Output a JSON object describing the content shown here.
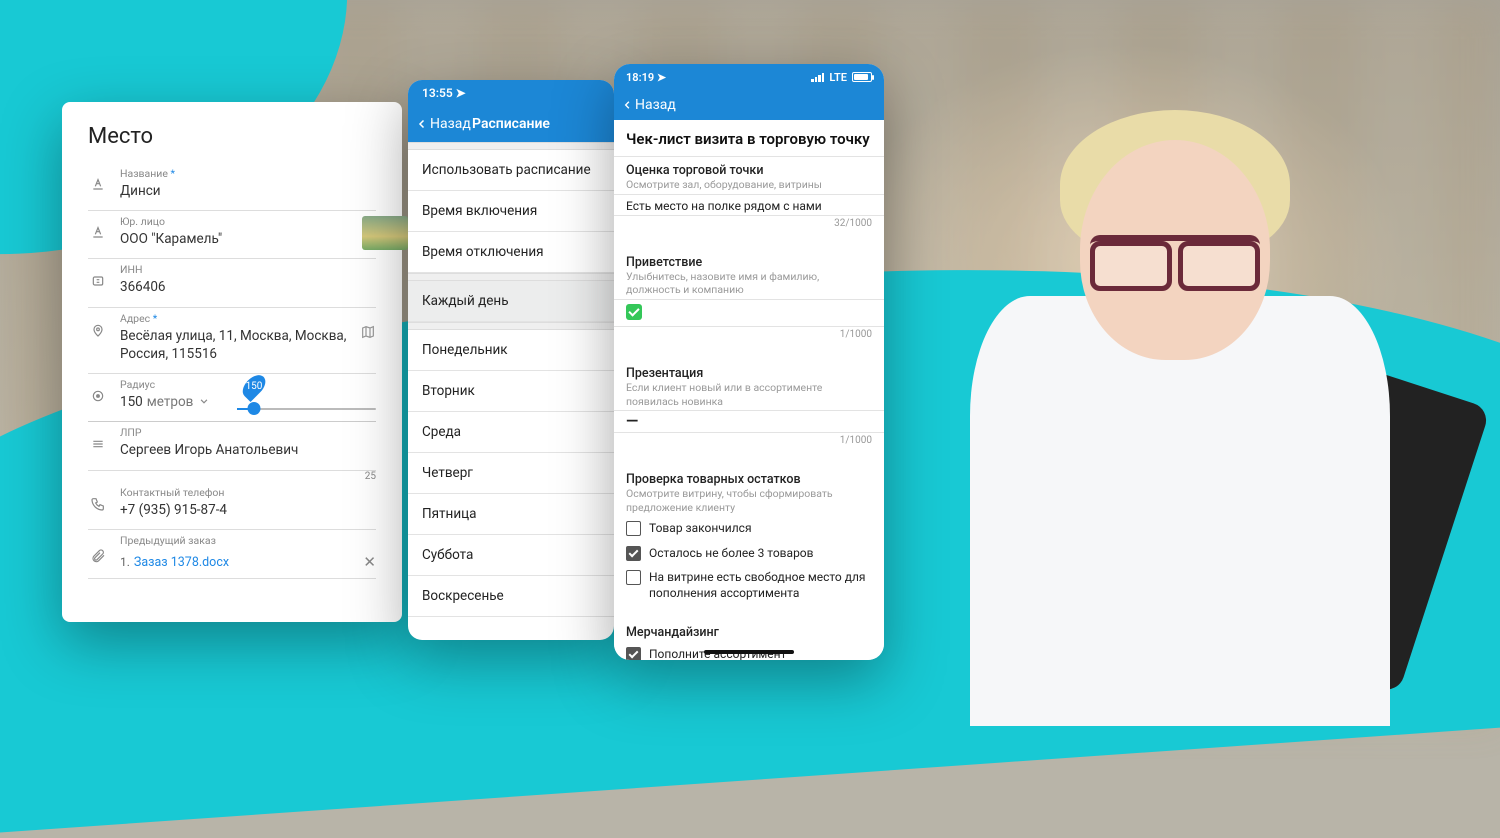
{
  "colors": {
    "accent": "#1c87d6",
    "teal": "#18c9d4",
    "link": "#1e88e5",
    "success": "#34c759"
  },
  "card1": {
    "title": "Место",
    "name": {
      "label": "Название",
      "value": "Динси"
    },
    "legal": {
      "label": "Юр. лицо",
      "value": "ООО \"Карамель\""
    },
    "inn": {
      "label": "ИНН",
      "value": "366406"
    },
    "address": {
      "label": "Адрес",
      "value": "Весёлая улица, 11, Москва, Москва, Россия, 115516"
    },
    "radius": {
      "label": "Радиус",
      "value": "150",
      "unit": "метров",
      "pin": "150",
      "percent": 12
    },
    "lpr": {
      "label": "ЛПР",
      "value": "Сергеев Игорь Анатольевич",
      "count": "25"
    },
    "phone": {
      "label": "Контактный телефон",
      "value": "+7 (935) 915-87-4"
    },
    "prev_order": {
      "label": "Предыдущий заказ",
      "file_num": "1.",
      "file_name": "Зазаз 1378.docx"
    }
  },
  "card2": {
    "time": "13:55",
    "back": "Назад",
    "title": "Расписание",
    "rows_top": [
      "Использовать расписание",
      "Время включения",
      "Время отключения"
    ],
    "rows_daily": "Каждый день",
    "days": [
      "Понедельник",
      "Вторник",
      "Среда",
      "Четверг",
      "Пятница",
      "Суббота",
      "Воскресенье"
    ]
  },
  "card3": {
    "time": "18:19",
    "net": "LTE",
    "back": "Назад",
    "title": "Чек-лист визита в торговую точку",
    "s1": {
      "title": "Оценка торговой точки",
      "sub": "Осмотрите зал, оборудование, витрины",
      "note": "Есть место на полке рядом с нами",
      "count": "32/1000"
    },
    "s2": {
      "title": "Приветствие",
      "sub": "Улыбнитесь, назовите имя и фамилию, должность и компанию",
      "count": "1/1000"
    },
    "s3": {
      "title": "Презентация",
      "sub": "Если клиент новый или в ассортименте появилась новинка",
      "count": "1/1000"
    },
    "s4": {
      "title": "Проверка товарных остатков",
      "sub": "Осмотрите витрину, чтобы сформировать предложение клиенту"
    },
    "checks": [
      {
        "label": "Товар закончился",
        "checked": false
      },
      {
        "label": "Осталось не более 3 товаров",
        "checked": true
      },
      {
        "label": "На витрине есть свободное место для пополнения ассортимента",
        "checked": false
      }
    ],
    "s5": {
      "title": "Мерчандайзинг"
    },
    "checks2": [
      {
        "label": "Пополните ассортимент",
        "checked": true
      }
    ]
  }
}
